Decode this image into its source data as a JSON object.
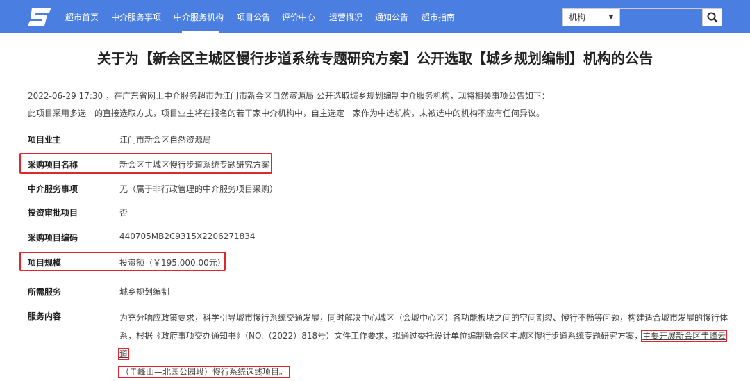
{
  "nav": {
    "items": [
      "超市首页",
      "中介服务事项",
      "中介服务机构",
      "项目公告",
      "评价中心",
      "运营概况",
      "通知公告",
      "超市指南"
    ],
    "active": "项目公告",
    "search_select": "机构",
    "brand_color": "#4a7ee0"
  },
  "title": "关于为【新会区主城区慢行步道系统专题研究方案】公开选取【城乡规划编制】机构的公告",
  "intro": [
    "2022-06-29 17:30 ，在广东省网上中介服务超市为江门市新会区自然资源局 公开选取城乡规划编制中介服务机构，现将相关事项公告如下：",
    "此项目采用多选一的直接选取方式，项目业主将在报名的若干家中介机构中，自主选定一家作为中选机构，未被选中的机构不应有任何异议。"
  ],
  "rows": [
    {
      "label": "项目业主",
      "value": "江门市新会区自然资源局"
    },
    {
      "label": "采购项目名称",
      "value": "新会区主城区慢行步道系统专题研究方案"
    },
    {
      "label": "中介服务事项",
      "value": "无（属于非行政管理的中介服务项目采购）"
    },
    {
      "label": "投资审批项目",
      "value": "否"
    },
    {
      "label": "采购项目编码",
      "value": "440705MB2C9315X2206271834"
    },
    {
      "label": "项目规模",
      "value": "投资额（￥195,000.00元）"
    },
    {
      "label": "所需服务",
      "value": "城乡规划编制"
    },
    {
      "label": "服务内容",
      "value": ""
    }
  ],
  "content": {
    "part1": "为充分响应政策要求，科学引导城市慢行系统交通发展，同时解决中心城区（会城中心区）各功能板块之间的空间割裂、慢行不畅等问题，构建适合城市发展的慢行体系，根据《政府事项交办通知书》（NO.（2022）818号）文件工作要求，拟通过委托设计单位编制新会区主城区慢行步道系统专题研究方案，",
    "highlight1": "主要开展新会区圭峰云道",
    "highlight2": "（圭峰山—北园公园段）慢行系统选线项目。"
  }
}
